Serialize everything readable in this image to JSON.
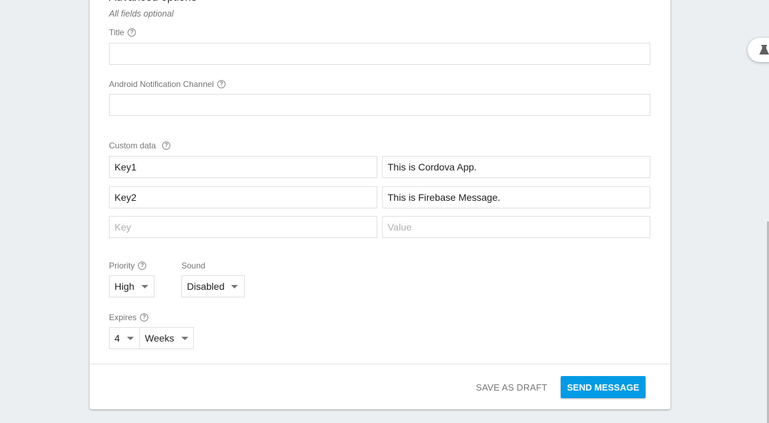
{
  "section": {
    "heading": "Advanced options",
    "subtitle": "All fields optional"
  },
  "fields": {
    "title": {
      "label": "Title",
      "value": ""
    },
    "android_channel": {
      "label": "Android Notification Channel",
      "value": ""
    }
  },
  "custom_data": {
    "label": "Custom data",
    "rows": [
      {
        "key": "Key1",
        "value": "This is Cordova App."
      },
      {
        "key": "Key2",
        "value": "This is Firebase Message."
      }
    ],
    "key_placeholder": "Key",
    "value_placeholder": "Value"
  },
  "priority": {
    "label": "Priority",
    "value": "High"
  },
  "sound": {
    "label": "Sound",
    "value": "Disabled"
  },
  "expires": {
    "label": "Expires",
    "amount": "4",
    "unit": "Weeks"
  },
  "actions": {
    "save_draft": "SAVE AS DRAFT",
    "send": "SEND MESSAGE"
  },
  "help_glyph": "?",
  "colors": {
    "primary": "#039be5",
    "background": "#eceff1"
  }
}
